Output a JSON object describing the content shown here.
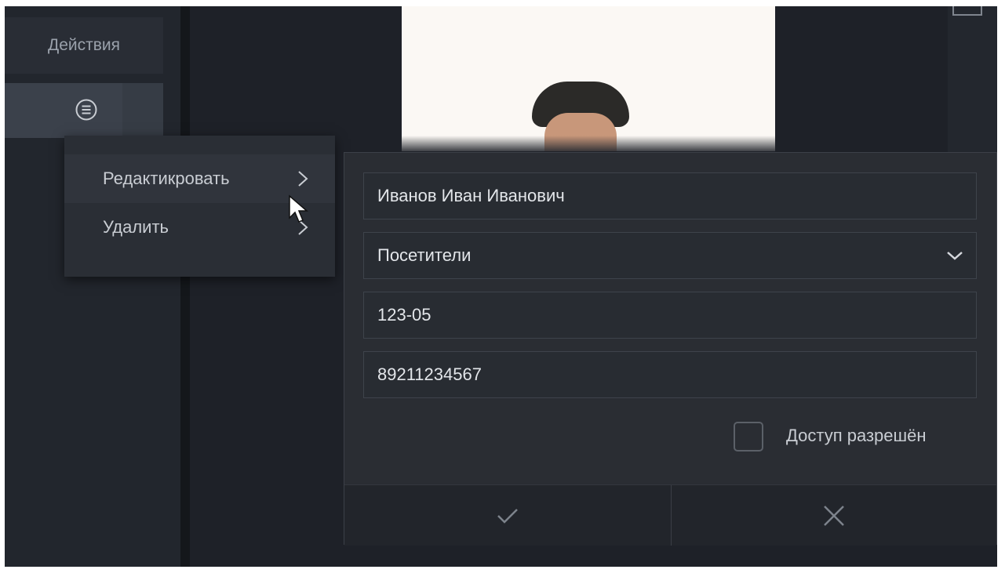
{
  "table": {
    "actions_header": "Действия",
    "row_menu_icon": "menu-icon"
  },
  "context_menu": {
    "items": [
      {
        "label": "Редактикровать",
        "icon": "chevron-right-icon"
      },
      {
        "label": "Удалить",
        "icon": "chevron-right-icon"
      }
    ]
  },
  "form": {
    "full_name": "Иванов Иван Иванович",
    "group": "Посетители",
    "card_number": "123-05",
    "phone": "89211234567",
    "access_label": "Доступ разрешён",
    "access_checked": false,
    "confirm_icon": "check-icon",
    "cancel_icon": "close-icon"
  },
  "colors": {
    "background": "#1e2128",
    "panel": "#2a2d33",
    "text": "#e3e6ea",
    "muted_text": "#9aa1ab"
  }
}
